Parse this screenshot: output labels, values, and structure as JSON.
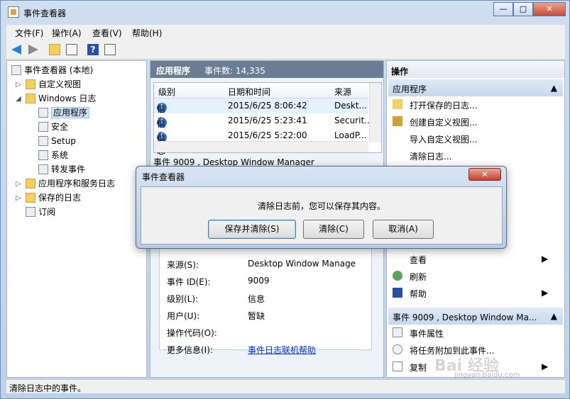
{
  "window": {
    "title": "事件查看器",
    "controls": [
      "—",
      "□",
      "✕"
    ]
  },
  "menu": [
    "文件(F)",
    "操作(A)",
    "查看(V)",
    "帮助(H)"
  ],
  "tree": [
    {
      "label": "事件查看器 (本地)"
    },
    {
      "label": "自定义视图"
    },
    {
      "label": "Windows 日志"
    },
    {
      "label": "应用程序"
    },
    {
      "label": "安全"
    },
    {
      "label": "Setup"
    },
    {
      "label": "系统"
    },
    {
      "label": "转发事件"
    },
    {
      "label": "应用程序和服务日志"
    },
    {
      "label": "保存的日志"
    },
    {
      "label": "订阅"
    }
  ],
  "center": {
    "title": "应用程序",
    "count": "事件数: 14,335",
    "columns": [
      "级别",
      "日期和时间",
      "来源"
    ],
    "rows": [
      {
        "level": "信息",
        "datetime": "2015/6/25 8:06:42",
        "source": "Deskt..."
      },
      {
        "level": "信息",
        "datetime": "2015/6/25 5:23:41",
        "source": "Securit..."
      },
      {
        "level": "信息",
        "datetime": "2015/6/25 5:22:00",
        "source": "LoadP..."
      }
    ],
    "detail_header": "事件 9009 , Desktop Window Manager",
    "detail_rows": [
      {
        "label": "来源(S):",
        "value": "Desktop Window Manage"
      },
      {
        "label": "事件 ID(E):",
        "value": "9009"
      },
      {
        "label": "级别(L):",
        "value": "信息"
      },
      {
        "label": "用户(U):",
        "value": "暂缺"
      },
      {
        "label": "操作代码(O):",
        "value": ""
      },
      {
        "label": "更多信息(I):",
        "value": "事件日志联机帮助"
      }
    ]
  },
  "actions": {
    "title": "操作",
    "section1": "应用程序",
    "items1": [
      "打开保存的日志...",
      "创建自定义视图...",
      "导入自定义视图...",
      "清除日志..."
    ],
    "items_mid": [
      "查看",
      "刷新",
      "帮助"
    ],
    "section2": "事件 9009 , Desktop Window Ma...",
    "items2": [
      "事件属性",
      "将任务附加到此事件...",
      "复制"
    ]
  },
  "status": "清除日志中的事件。",
  "dialog": {
    "title": "事件查看器",
    "message": "清除日志前，您可以保存其内容。",
    "save_clear": "保存并清除(S)",
    "clear": "清除(C)",
    "cancel": "取消(A)",
    "close": "✕"
  },
  "watermark": {
    "brand": "Bai 经验",
    "url": "jingyan.baidu.com"
  }
}
